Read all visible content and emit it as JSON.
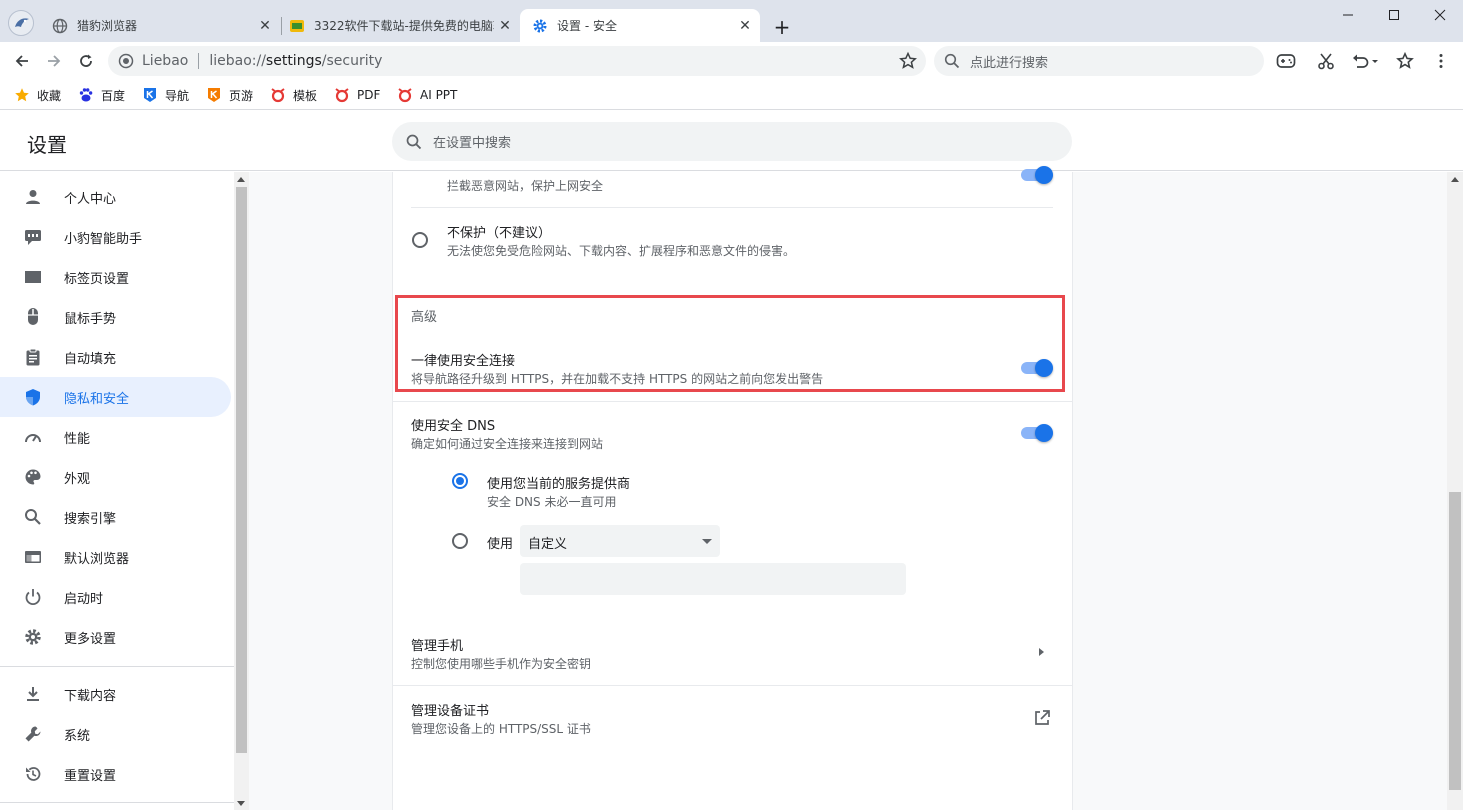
{
  "tabs": [
    {
      "title": "猎豹浏览器",
      "active": false
    },
    {
      "title": "3322软件下载站-提供免费的电脑软件",
      "active": false
    },
    {
      "title": "设置 - 安全",
      "active": true
    }
  ],
  "omnibox": {
    "brand": "Liebao",
    "url_prefix": "liebao://",
    "url_host": "settings",
    "url_path": "/security"
  },
  "search": {
    "placeholder": "点此进行搜索"
  },
  "bookmarks": [
    {
      "label": "收藏",
      "icon": "star-icon"
    },
    {
      "label": "百度",
      "icon": "baidu-icon"
    },
    {
      "label": "导航",
      "icon": "nav-icon"
    },
    {
      "label": "页游",
      "icon": "game-icon"
    },
    {
      "label": "模板",
      "icon": "template-icon"
    },
    {
      "label": "PDF",
      "icon": "pdf-icon"
    },
    {
      "label": "AI PPT",
      "icon": "ai-ppt-icon"
    }
  ],
  "settings": {
    "title": "设置",
    "search_placeholder": "在设置中搜索"
  },
  "sidebar": {
    "items": [
      {
        "label": "个人中心",
        "icon": "person-icon"
      },
      {
        "label": "小豹智能助手",
        "icon": "assistant-icon"
      },
      {
        "label": "标签页设置",
        "icon": "tab-icon"
      },
      {
        "label": "鼠标手势",
        "icon": "mouse-icon"
      },
      {
        "label": "自动填充",
        "icon": "clipboard-icon"
      },
      {
        "label": "隐私和安全",
        "icon": "shield-icon",
        "active": true
      },
      {
        "label": "性能",
        "icon": "speedometer-icon"
      },
      {
        "label": "外观",
        "icon": "palette-icon"
      },
      {
        "label": "搜索引擎",
        "icon": "search-icon"
      },
      {
        "label": "默认浏览器",
        "icon": "browser-icon"
      },
      {
        "label": "启动时",
        "icon": "power-icon"
      },
      {
        "label": "更多设置",
        "icon": "gear-icon"
      }
    ],
    "extra_items": [
      {
        "label": "下载内容",
        "icon": "download-icon"
      },
      {
        "label": "系统",
        "icon": "wrench-icon"
      },
      {
        "label": "重置设置",
        "icon": "reset-icon"
      }
    ]
  },
  "content": {
    "standard_protection_desc": "拦截恶意网站，保护上网安全",
    "no_protection_title": "不保护（不建议）",
    "no_protection_desc": "无法使您免受危险网站、下载内容、扩展程序和恶意文件的侵害。",
    "advanced_heading": "高级",
    "https_title": "一律使用安全连接",
    "https_desc": "将导航路径升级到 HTTPS，并在加载不支持 HTTPS 的网站之前向您发出警告",
    "https_enabled": true,
    "dns_title": "使用安全 DNS",
    "dns_desc": "确定如何通过安全连接来连接到网站",
    "dns_enabled": true,
    "dns_current_title": "使用您当前的服务提供商",
    "dns_current_desc": "安全 DNS 未必一直可用",
    "dns_use_label": "使用",
    "dns_select_value": "自定义",
    "manage_phones_title": "管理手机",
    "manage_phones_desc": "控制您使用哪些手机作为安全密钥",
    "manage_certs_title": "管理设备证书",
    "manage_certs_desc": "管理您设备上的 HTTPS/SSL 证书"
  },
  "colors": {
    "accent": "#1a73e8",
    "highlight": "#e8484d",
    "tabstrip": "#dee3ec"
  }
}
